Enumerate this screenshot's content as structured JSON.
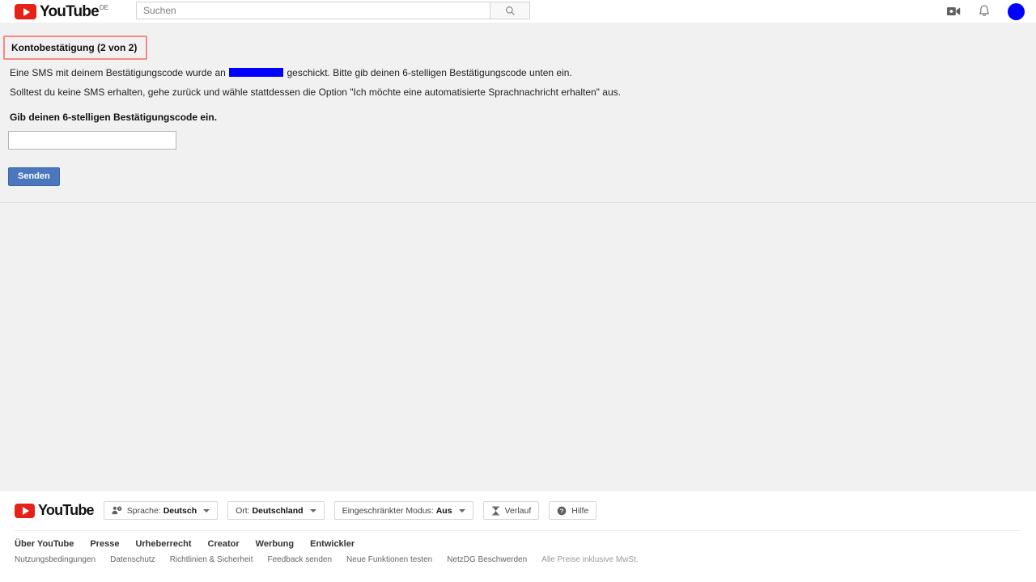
{
  "header": {
    "logo_text": "YouTube",
    "logo_country": "DE",
    "logo_icon": "youtube-play-icon",
    "search": {
      "placeholder": "Suchen",
      "value": "",
      "button_icon": "search-icon"
    },
    "icons": [
      {
        "name": "create-video-icon",
        "glyph": "video-camera-plus"
      },
      {
        "name": "notifications-bell-icon",
        "glyph": "bell"
      }
    ],
    "avatar": {
      "name": "account-avatar",
      "color": "#0000ff"
    }
  },
  "main": {
    "title": "Kontobestätigung (2 von 2)",
    "title_border_color": "#ef8a87",
    "paragraph_1_before": "Eine SMS mit deinem Bestätigungscode wurde an",
    "redacted_color": "#0000ff",
    "paragraph_1_after": "geschickt. Bitte gib deinen 6-stelligen Bestätigungscode unten ein.",
    "paragraph_2": "Solltest du keine SMS erhalten, gehe zurück und wähle stattdessen die Option \"Ich möchte eine automatisierte Sprachnachricht erhalten\" aus.",
    "field_label": "Gib deinen 6-stelligen Bestätigungscode ein.",
    "code_input_value": "",
    "code_input_placeholder": "",
    "submit_label": "Senden",
    "submit_color": "#4a77bd"
  },
  "footer": {
    "logo_text": "YouTube",
    "logo_icon": "youtube-play-icon",
    "pills": [
      {
        "name": "language-selector",
        "icon": "person-question-icon",
        "prefix": "Sprache: ",
        "value": "Deutsch",
        "caret": true
      },
      {
        "name": "location-selector",
        "icon": "",
        "prefix": "Ort: ",
        "value": "Deutschland",
        "caret": true
      },
      {
        "name": "restricted-mode-selector",
        "icon": "",
        "prefix": "Eingeschränkter Modus: ",
        "value": "Aus",
        "caret": true
      },
      {
        "name": "history-button",
        "icon": "hourglass-icon",
        "prefix": "",
        "value": "Verlauf",
        "caret": false
      },
      {
        "name": "help-button",
        "icon": "help-circle-icon",
        "prefix": "",
        "value": "Hilfe",
        "caret": false
      }
    ],
    "links_primary": [
      "Über YouTube",
      "Presse",
      "Urheberrecht",
      "Creator",
      "Werbung",
      "Entwickler"
    ],
    "links_secondary": [
      "Nutzungsbedingungen",
      "Datenschutz",
      "Richtlinien & Sicherheit",
      "Feedback senden",
      "Neue Funktionen testen",
      "NetzDG Beschwerden"
    ],
    "static_note": "Alle Preise inklusive MwSt."
  }
}
